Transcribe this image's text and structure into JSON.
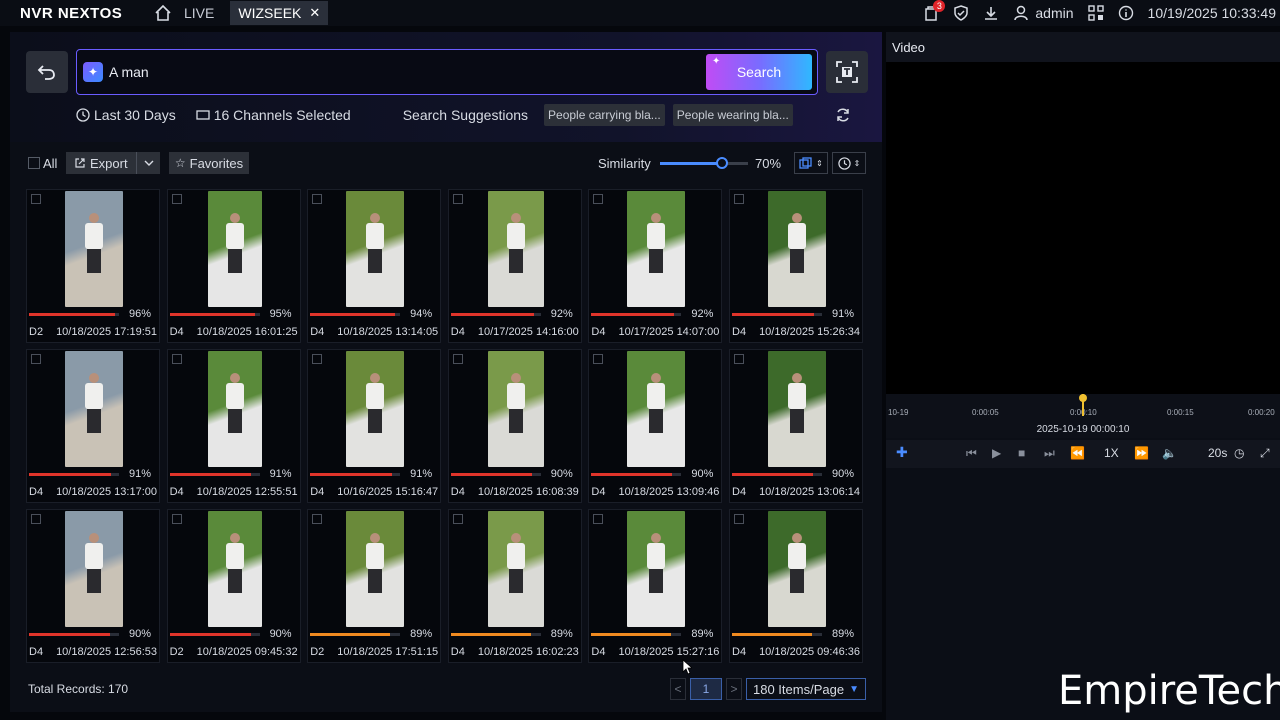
{
  "topbar": {
    "brand": "NVR NEXTOS",
    "nav_live": "LIVE",
    "tab_active": "WIZSEEK",
    "notif_count": "3",
    "user": "admin",
    "datetime": "10/19/2025 10:33:49"
  },
  "search": {
    "query": "A man",
    "button_label": "Search",
    "range_label": "Last 30 Days",
    "channels_label": "16 Channels Selected",
    "suggestions_label": "Search Suggestions",
    "suggestions": [
      "People carrying bla...",
      "People wearing bla..."
    ]
  },
  "toolbar": {
    "all_label": "All",
    "export_label": "Export",
    "favorites_label": "Favorites",
    "similarity_label": "Similarity",
    "similarity_value": 0.7,
    "similarity_text": "70%"
  },
  "results": [
    {
      "pct": "96%",
      "value": 0.96,
      "ch": "D2",
      "time": "10/18/2025 17:19:51",
      "color": "#e0342a"
    },
    {
      "pct": "95%",
      "value": 0.95,
      "ch": "D4",
      "time": "10/18/2025 16:01:25",
      "color": "#e0342a"
    },
    {
      "pct": "94%",
      "value": 0.94,
      "ch": "D4",
      "time": "10/18/2025 13:14:05",
      "color": "#e0342a"
    },
    {
      "pct": "92%",
      "value": 0.92,
      "ch": "D4",
      "time": "10/17/2025 14:16:00",
      "color": "#e0342a"
    },
    {
      "pct": "92%",
      "value": 0.92,
      "ch": "D4",
      "time": "10/17/2025 14:07:00",
      "color": "#e0342a"
    },
    {
      "pct": "91%",
      "value": 0.91,
      "ch": "D4",
      "time": "10/18/2025 15:26:34",
      "color": "#e0342a"
    },
    {
      "pct": "91%",
      "value": 0.91,
      "ch": "D4",
      "time": "10/18/2025 13:17:00",
      "color": "#e0342a"
    },
    {
      "pct": "91%",
      "value": 0.91,
      "ch": "D4",
      "time": "10/18/2025 12:55:51",
      "color": "#e0342a"
    },
    {
      "pct": "91%",
      "value": 0.91,
      "ch": "D4",
      "time": "10/16/2025 15:16:47",
      "color": "#e0342a"
    },
    {
      "pct": "90%",
      "value": 0.9,
      "ch": "D4",
      "time": "10/18/2025 16:08:39",
      "color": "#e0342a"
    },
    {
      "pct": "90%",
      "value": 0.9,
      "ch": "D4",
      "time": "10/18/2025 13:09:46",
      "color": "#e0342a"
    },
    {
      "pct": "90%",
      "value": 0.9,
      "ch": "D4",
      "time": "10/18/2025 13:06:14",
      "color": "#e0342a"
    },
    {
      "pct": "90%",
      "value": 0.9,
      "ch": "D4",
      "time": "10/18/2025 12:56:53",
      "color": "#e0342a"
    },
    {
      "pct": "90%",
      "value": 0.9,
      "ch": "D2",
      "time": "10/18/2025 09:45:32",
      "color": "#e0342a"
    },
    {
      "pct": "89%",
      "value": 0.89,
      "ch": "D2",
      "time": "10/18/2025 17:51:15",
      "color": "#f08a20"
    },
    {
      "pct": "89%",
      "value": 0.89,
      "ch": "D4",
      "time": "10/18/2025 16:02:23",
      "color": "#f08a20"
    },
    {
      "pct": "89%",
      "value": 0.89,
      "ch": "D4",
      "time": "10/18/2025 15:27:16",
      "color": "#f08a20"
    },
    {
      "pct": "89%",
      "value": 0.89,
      "ch": "D4",
      "time": "10/18/2025 09:46:36",
      "color": "#f08a20"
    }
  ],
  "footer": {
    "total": "Total Records: 170",
    "page": "1",
    "page_size": "180 Items/Page"
  },
  "video": {
    "title": "Video",
    "ticks": [
      "10-19",
      "0:00:05",
      "0:00:10",
      "0:00:15",
      "0:00:20"
    ],
    "date": "2025-10-19 00:00:10",
    "speed": "1X",
    "interval": "20s"
  },
  "watermark": "EmpireTech"
}
